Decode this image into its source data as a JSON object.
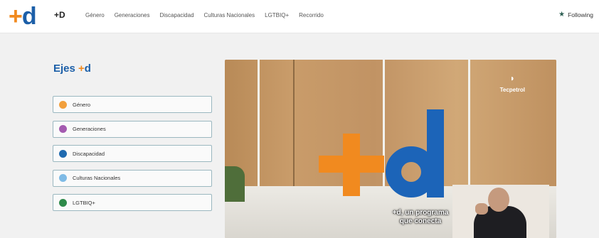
{
  "header": {
    "logo": {
      "plus": "+",
      "d": "d"
    },
    "site_name": "+D",
    "nav": [
      "Género",
      "Generaciones",
      "Discapacidad",
      "Culturas Nacionales",
      "LGTBIQ+",
      "Recorrido"
    ],
    "following_label": "Following"
  },
  "axes": {
    "title_main": "Ejes ",
    "title_plus": "+",
    "title_d": "d",
    "items": [
      {
        "label": "Género",
        "color": "#f2a03d"
      },
      {
        "label": "Generaciones",
        "color": "#a45bb0"
      },
      {
        "label": "Discapacidad",
        "color": "#1f6ab0"
      },
      {
        "label": "Culturas Nacionales",
        "color": "#7fbbe6"
      },
      {
        "label": "LGTBIQ+",
        "color": "#2e8a4a"
      }
    ]
  },
  "video": {
    "brand": "Tecpetrol",
    "caption_line1": "+d, un programa",
    "caption_line2": "que conecta"
  },
  "colors": {
    "accent_orange": "#f18a1f",
    "accent_blue": "#1c5fa8"
  }
}
